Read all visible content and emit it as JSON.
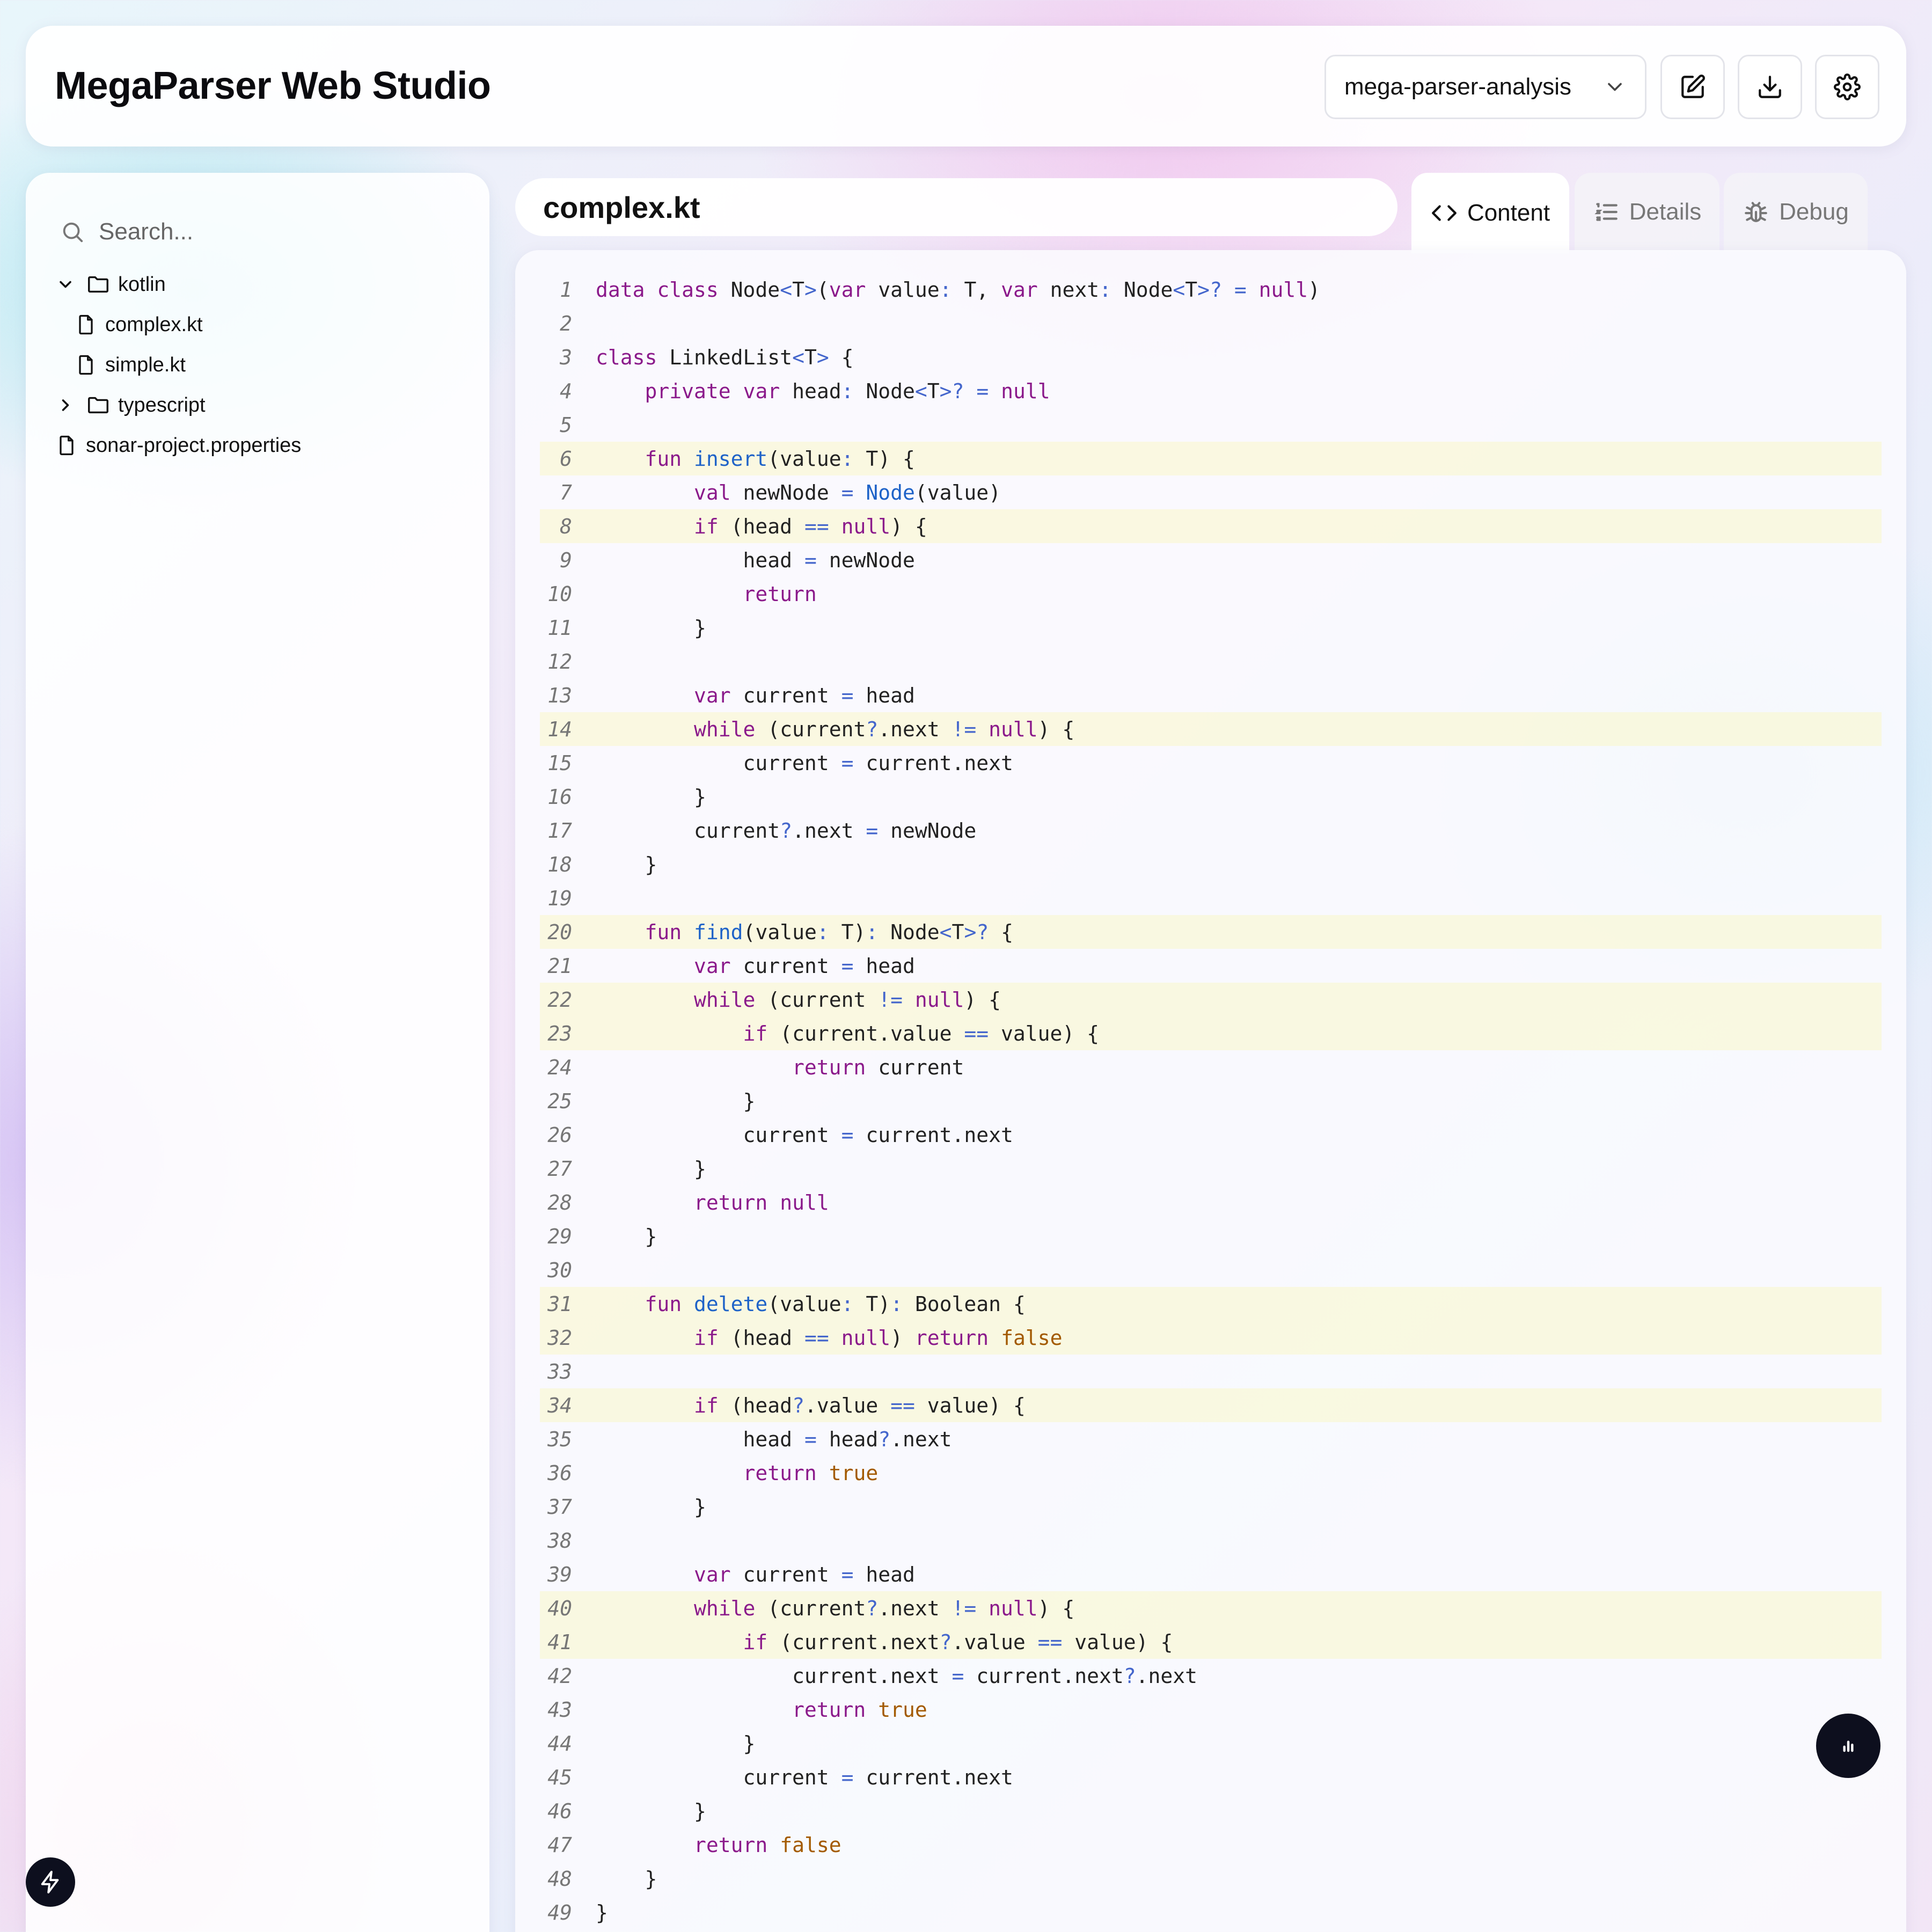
{
  "header": {
    "title": "MegaParser Web Studio",
    "project_select": {
      "value": "mega-parser-analysis"
    },
    "icons": [
      "edit-icon",
      "download-icon",
      "gear-icon"
    ]
  },
  "sidebar": {
    "search_placeholder": "Search...",
    "tree": [
      {
        "label": "kotlin",
        "type": "folder",
        "expanded": true
      },
      {
        "label": "complex.kt",
        "type": "file"
      },
      {
        "label": "simple.kt",
        "type": "file"
      },
      {
        "label": "typescript",
        "type": "folder",
        "expanded": false
      },
      {
        "label": "sonar-project.properties",
        "type": "file"
      }
    ]
  },
  "editor": {
    "file_name": "complex.kt",
    "tabs": [
      {
        "label": "Content",
        "icon": "code-icon",
        "active": true
      },
      {
        "label": "Details",
        "icon": "list-icon",
        "active": false
      },
      {
        "label": "Debug",
        "icon": "bug-icon",
        "active": false
      }
    ],
    "highlighted_lines": [
      6,
      8,
      14,
      20,
      22,
      23,
      31,
      32,
      34,
      40,
      41
    ],
    "lines": [
      "data class Node<T>(var value: T, var next: Node<T>? = null)",
      "",
      "class LinkedList<T> {",
      "    private var head: Node<T>? = null",
      "",
      "    fun insert(value: T) {",
      "        val newNode = Node(value)",
      "        if (head == null) {",
      "            head = newNode",
      "            return",
      "        }",
      "",
      "        var current = head",
      "        while (current?.next != null) {",
      "            current = current.next",
      "        }",
      "        current?.next = newNode",
      "    }",
      "",
      "    fun find(value: T): Node<T>? {",
      "        var current = head",
      "        while (current != null) {",
      "            if (current.value == value) {",
      "                return current",
      "            }",
      "            current = current.next",
      "        }",
      "        return null",
      "    }",
      "",
      "    fun delete(value: T): Boolean {",
      "        if (head == null) return false",
      "",
      "        if (head?.value == value) {",
      "            head = head?.next",
      "            return true",
      "        }",
      "",
      "        var current = head",
      "        while (current?.next != null) {",
      "            if (current.next?.value == value) {",
      "                current.next = current.next?.next",
      "                return true",
      "            }",
      "            current = current.next",
      "        }",
      "        return false",
      "    }",
      "}"
    ]
  },
  "fabs": [
    "chart-icon",
    "bolt-icon"
  ],
  "colors": {
    "keyword": "#8b1a8b",
    "function": "#1f63c8",
    "operator": "#4466cc",
    "boolean": "#a35a00",
    "highlight": "#faf8c8",
    "fab": "#0d0f1e"
  }
}
